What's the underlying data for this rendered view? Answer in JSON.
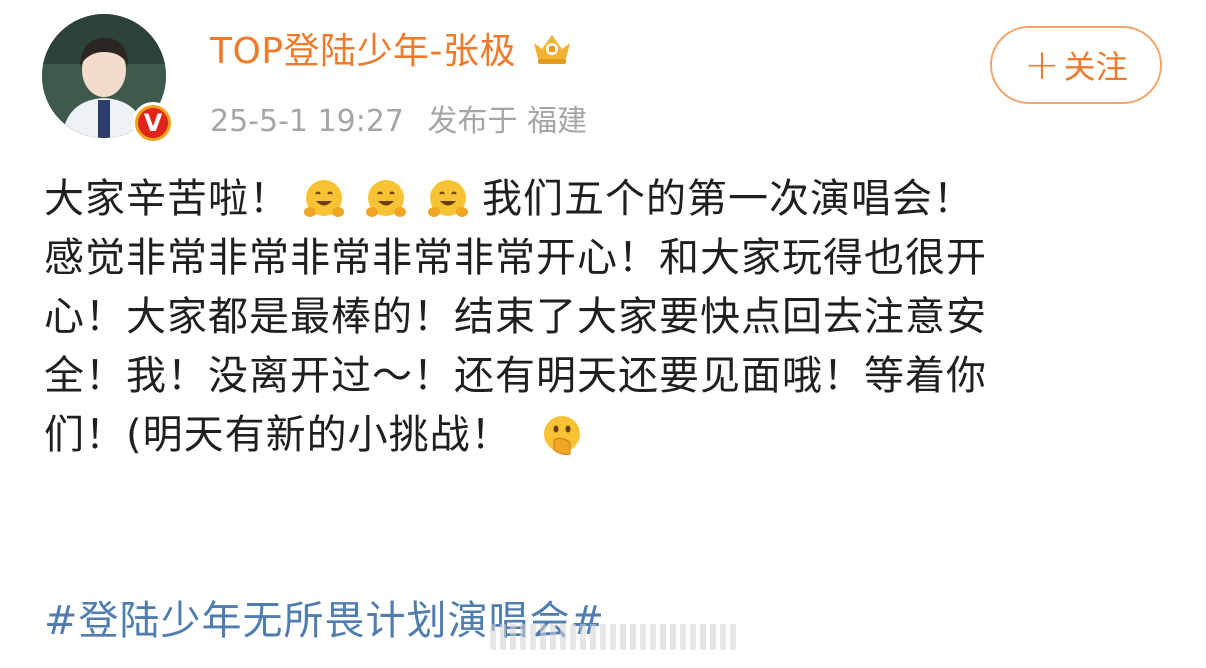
{
  "user": {
    "name": "TOP登陆少年-张极",
    "timestamp": "25-5-1 19:27",
    "posted_from": "发布于 福建",
    "verified_badge_label": "V"
  },
  "follow_button": {
    "icon": "+",
    "label": "关注"
  },
  "post": {
    "lines": [
      {
        "a": "大家辛苦啦！",
        "b": "我们五个的第一次演唱会！"
      },
      {
        "a": "感觉非常非常非常非常非常开心！和大家玩得也很开"
      },
      {
        "a": "心！大家都是最棒的！结束了大家要快点回去注意安"
      },
      {
        "a": "全！我！没离开过～！还有明天还要见面哦！等着你"
      },
      {
        "a": "们！(明天有新的小挑战！"
      }
    ],
    "hashtag": "#登陆少年无所畏计划演唱会#"
  },
  "icons": {
    "verified": "verified-v-icon",
    "vip_badge": "crown-badge-icon",
    "hug_emoji": "hugging-face-emoji",
    "hand_over_mouth_emoji": "face-with-hand-over-mouth-emoji"
  },
  "colors": {
    "username": "#ee7a2a",
    "meta": "#a6a6a6",
    "hashtag": "#507daf",
    "follow_border": "#f2a469"
  }
}
